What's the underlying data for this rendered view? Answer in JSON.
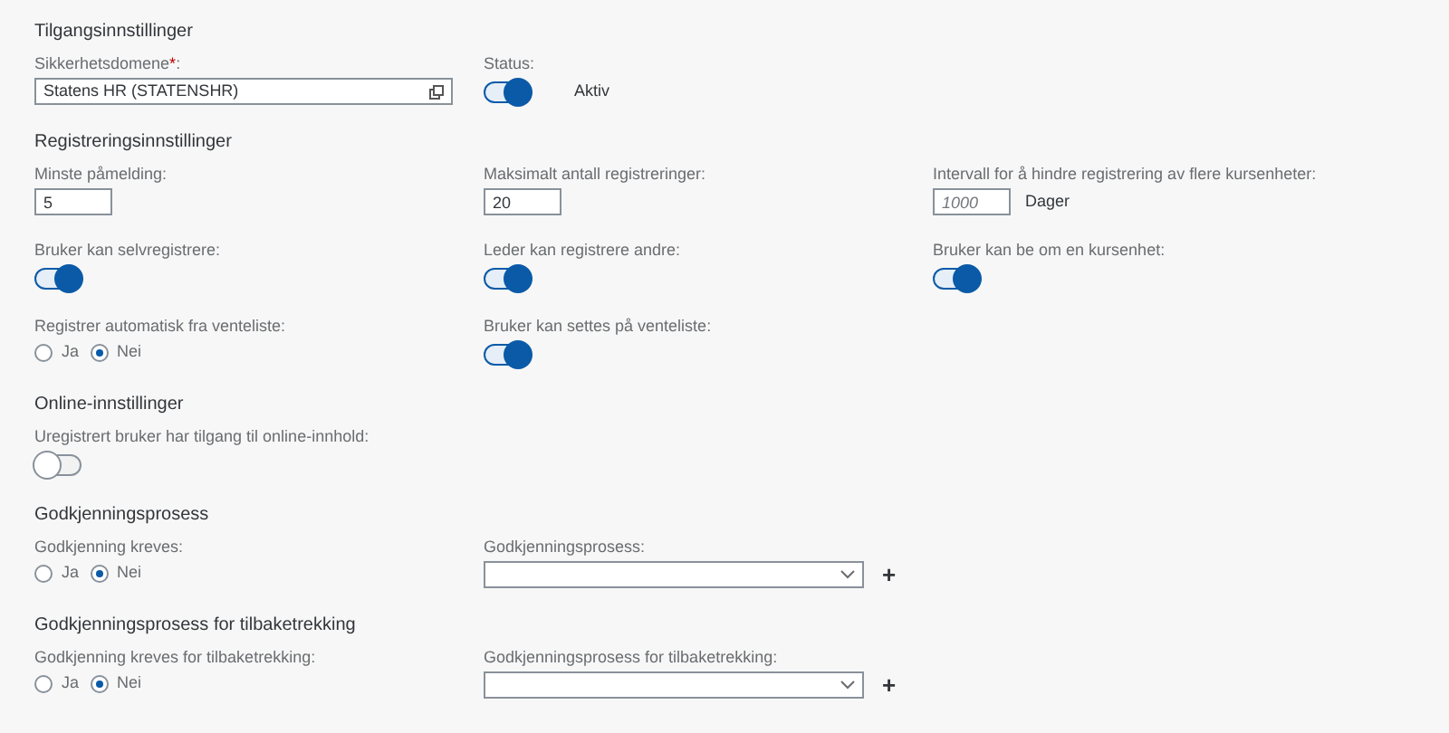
{
  "sections": [
    {
      "title": "Tilgangsinnstillinger",
      "rows": [
        [
          {
            "kind": "lookup",
            "label": "Sikkerhetsdomene",
            "required": "*",
            "suffix": ":",
            "value": "Statens HR (STATENSHR)"
          },
          {
            "kind": "toggle",
            "label": "Status:",
            "on": true,
            "text": "Aktiv"
          }
        ]
      ]
    },
    {
      "title": "Registreringsinnstillinger",
      "rows": [
        [
          {
            "kind": "number",
            "label": "Minste påmelding:",
            "value": "5"
          },
          {
            "kind": "number",
            "label": "Maksimalt antall registreringer:",
            "value": "20"
          },
          {
            "kind": "number",
            "label": "Intervall for å hindre registrering av flere kursenheter:",
            "placeholder": "1000",
            "unit": "Dager"
          }
        ],
        [
          {
            "kind": "toggle",
            "label": "Bruker kan selvregistrere:",
            "on": true
          },
          {
            "kind": "toggle",
            "label": "Leder kan registrere andre:",
            "on": true
          },
          {
            "kind": "toggle",
            "label": "Bruker kan be om en kursenhet:",
            "on": true
          }
        ],
        [
          {
            "kind": "radio",
            "label": "Registrer automatisk fra venteliste:",
            "options": [
              {
                "label": "Ja",
                "selected": false
              },
              {
                "label": "Nei",
                "selected": true
              }
            ]
          },
          {
            "kind": "toggle",
            "label": "Bruker kan settes på venteliste:",
            "on": true
          }
        ]
      ]
    },
    {
      "title": "Online-innstillinger",
      "rows": [
        [
          {
            "kind": "toggle",
            "label": "Uregistrert bruker har tilgang til online-innhold:",
            "on": false
          }
        ]
      ]
    },
    {
      "title": "Godkjenningsprosess",
      "rows": [
        [
          {
            "kind": "radio",
            "label": "Godkjenning kreves:",
            "options": [
              {
                "label": "Ja",
                "selected": false
              },
              {
                "label": "Nei",
                "selected": true
              }
            ]
          },
          {
            "kind": "select",
            "label": "Godkjenningsprosess:",
            "add": "+"
          }
        ]
      ]
    },
    {
      "title": "Godkjenningsprosess for tilbaketrekking",
      "rows": [
        [
          {
            "kind": "radio",
            "label": "Godkjenning kreves for tilbaketrekking:",
            "options": [
              {
                "label": "Ja",
                "selected": false
              },
              {
                "label": "Nei",
                "selected": true
              }
            ]
          },
          {
            "kind": "select",
            "label": "Godkjenningsprosess for tilbaketrekking:",
            "add": "+"
          }
        ]
      ]
    }
  ]
}
